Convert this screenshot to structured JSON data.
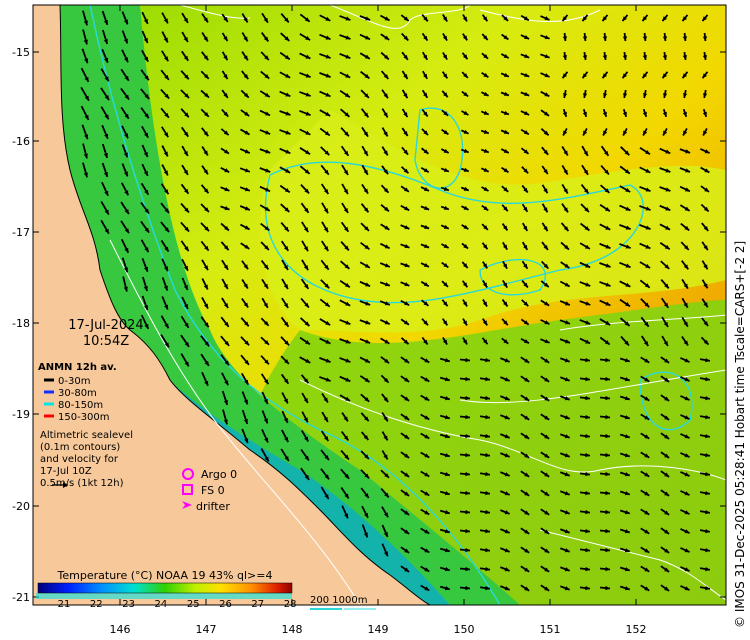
{
  "map": {
    "date": "17-Jul-2024",
    "time": "10:54Z",
    "lon_ticks": [
      "146",
      "147",
      "148",
      "149",
      "150",
      "151",
      "152"
    ],
    "lat_ticks": [
      "-15",
      "-16",
      "-17",
      "-18",
      "-19",
      "-20",
      "-21"
    ],
    "land_color": "#f7c99a",
    "arrow_color": "#000000",
    "contour_color": "#ffffff",
    "isobath_color": "#2ad8dc"
  },
  "legend": {
    "anmn_title": "ANMN 12h av.",
    "depths": [
      {
        "label": "0-30m",
        "color": "#000000"
      },
      {
        "label": "30-80m",
        "color": "#1030ff"
      },
      {
        "label": "80-150m",
        "color": "#00e5e5"
      },
      {
        "label": "150-300m",
        "color": "#ff0000"
      }
    ],
    "altimetry": [
      "Altimetric sealevel",
      "(0.1m contours)",
      "and velocity for",
      "17-Jul 10Z"
    ],
    "scale_label": "0.5m/s (1kt 12h)",
    "argo_label": "Argo 0",
    "fs_label": "FS 0",
    "drifter_label": "drifter",
    "marker_color": "#ff00ff"
  },
  "colorbar": {
    "title": "Temperature (°C) NOAA 19 43% ql>=4",
    "ticks": [
      "21",
      "22",
      "23",
      "24",
      "25",
      "26",
      "27",
      "28"
    ]
  },
  "isobath_scale": "200  1000m",
  "credit": "© IMOS 31-Dec-2025 05:28:41 Hobart time Tscale=CARS+[-2 2]"
}
